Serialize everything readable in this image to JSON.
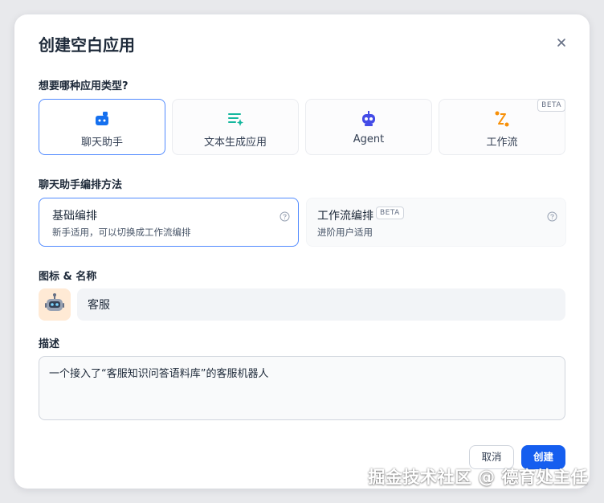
{
  "dialog": {
    "title": "创建空白应用"
  },
  "app_type": {
    "label": "想要哪种应用类型?",
    "options": [
      {
        "label": "聊天助手",
        "icon": "chat-bot-icon",
        "selected": true
      },
      {
        "label": "文本生成应用",
        "icon": "text-sparkle-icon",
        "selected": false
      },
      {
        "label": "Agent",
        "icon": "robot-icon",
        "selected": false
      },
      {
        "label": "工作流",
        "icon": "workflow-icon",
        "selected": false,
        "badge": "BETA"
      }
    ]
  },
  "method": {
    "label": "聊天助手编排方法",
    "options": [
      {
        "title": "基础编排",
        "desc": "新手适用，可以切换成工作流编排",
        "selected": true
      },
      {
        "title": "工作流编排",
        "desc": "进阶用户适用",
        "badge": "BETA",
        "selected": false
      }
    ]
  },
  "icon_name": {
    "label": "图标 & 名称",
    "avatar": "🤖",
    "name_value": "客服"
  },
  "description": {
    "label": "描述",
    "value": "一个接入了“客服知识问答语料库”的客服机器人"
  },
  "actions": {
    "cancel": "取消",
    "create": "创建"
  },
  "colors": {
    "accent": "#155eef",
    "selected_border": "#528bff"
  },
  "watermark": "掘金技术社区 @ 德育处主任"
}
